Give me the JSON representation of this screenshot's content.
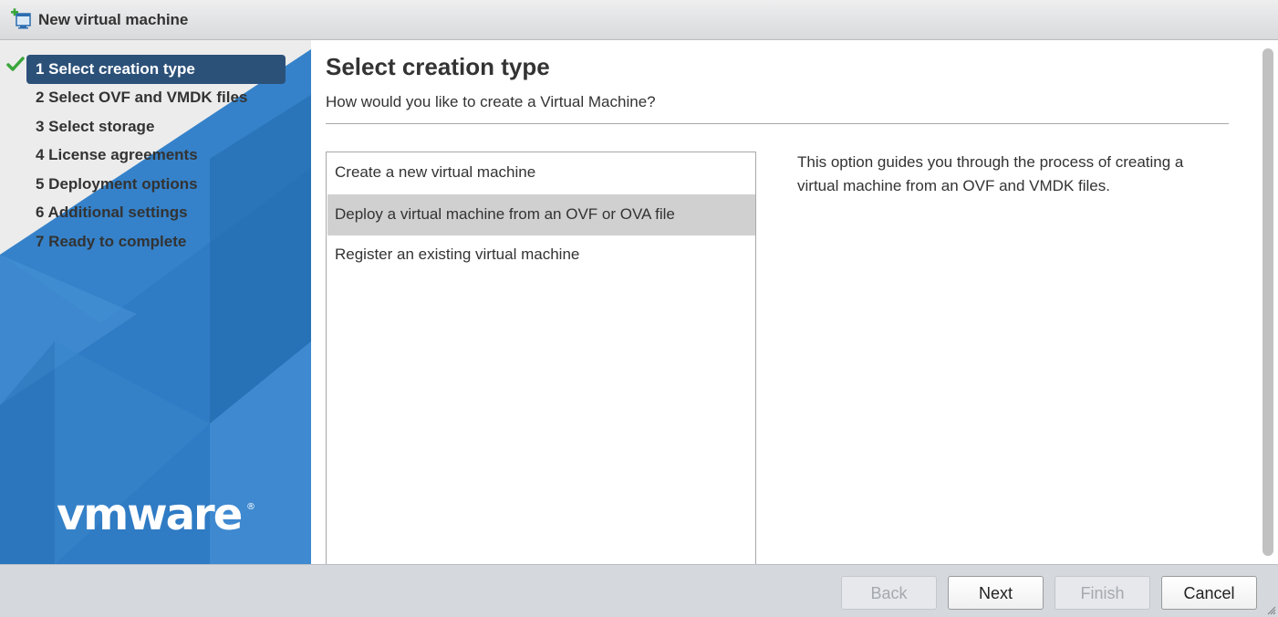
{
  "window": {
    "title": "New virtual machine",
    "icon": "new-vm-icon"
  },
  "sidebar": {
    "logo_text": "vmware",
    "steps": [
      {
        "label": "1 Select creation type",
        "state": "active",
        "completed": true
      },
      {
        "label": "2 Select OVF and VMDK files",
        "state": "pending"
      },
      {
        "label": "3 Select storage",
        "state": "pending"
      },
      {
        "label": "4 License agreements",
        "state": "pending"
      },
      {
        "label": "5 Deployment options",
        "state": "pending"
      },
      {
        "label": "6 Additional settings",
        "state": "pending"
      },
      {
        "label": "7 Ready to complete",
        "state": "pending"
      }
    ]
  },
  "main": {
    "title": "Select creation type",
    "subtitle": "How would you like to create a Virtual Machine?",
    "options": [
      {
        "label": "Create a new virtual machine",
        "selected": false
      },
      {
        "label": "Deploy a virtual machine from an OVF or OVA file",
        "selected": true
      },
      {
        "label": "Register an existing virtual machine",
        "selected": false
      }
    ],
    "description": "This option guides you through the process of creating a virtual machine from an OVF and VMDK files."
  },
  "footer": {
    "back_label": "Back",
    "next_label": "Next",
    "finish_label": "Finish",
    "cancel_label": "Cancel",
    "back_enabled": false,
    "next_enabled": true,
    "finish_enabled": false,
    "cancel_enabled": true
  },
  "colors": {
    "active_step_bg": "#2c5179",
    "sidebar_blue": "#2f7bc4",
    "selected_option_bg": "#d0d0d0",
    "check_green": "#3aa63a",
    "footer_bg": "#d5d9de"
  }
}
